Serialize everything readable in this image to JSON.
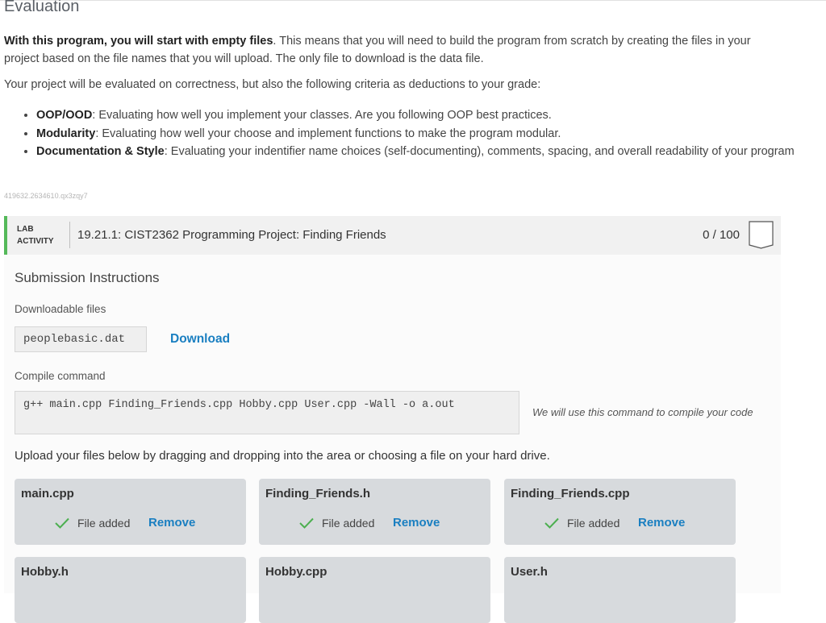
{
  "section": {
    "title": "Evaluation",
    "intro_bold": "With this program, you will start with empty files",
    "intro_rest": ". This means that you will need to build the program from scratch by creating the files in your project based on the file names that you will upload. The only file to download is the data file.",
    "criteria_intro": "Your project will be evaluated on correctness, but also the following criteria as deductions to your grade:",
    "criteria": [
      {
        "term": "OOP/OOD",
        "desc": ": Evaluating how well you implement your classes. Are you following OOP best practices."
      },
      {
        "term": "Modularity",
        "desc": ": Evaluating how well your choose and implement functions to make the program modular."
      },
      {
        "term": "Documentation & Style",
        "desc": ": Evaluating your indentifier name choices (self-documenting), comments, spacing, and overall readability of your program"
      }
    ],
    "tracking_id": "419632.2634610.qx3zqy7"
  },
  "lab": {
    "tag_line1": "LAB",
    "tag_line2": "ACTIVITY",
    "title": "19.21.1: CIST2362 Programming Project: Finding Friends",
    "score": "0 / 100",
    "accent_color": "#55b95a"
  },
  "submission": {
    "title": "Submission Instructions",
    "downloadable_label": "Downloadable files",
    "file_name": "peoplebasic.dat",
    "download_label": "Download",
    "compile_label": "Compile command",
    "compile_command": "g++ main.cpp Finding_Friends.cpp Hobby.cpp User.cpp -Wall -o a.out",
    "compile_note": "We will use this command to compile your code",
    "upload_text": "Upload your files below by dragging and dropping into the area or choosing a file on your hard drive.",
    "file_slots": [
      {
        "name": "main.cpp",
        "status": "File added",
        "action": "Remove"
      },
      {
        "name": "Finding_Friends.h",
        "status": "File added",
        "action": "Remove"
      },
      {
        "name": "Finding_Friends.cpp",
        "status": "File added",
        "action": "Remove"
      },
      {
        "name": "Hobby.h"
      },
      {
        "name": "Hobby.cpp"
      },
      {
        "name": "User.h"
      }
    ],
    "link_color": "#1a7fc1",
    "check_color": "#4caf50"
  }
}
